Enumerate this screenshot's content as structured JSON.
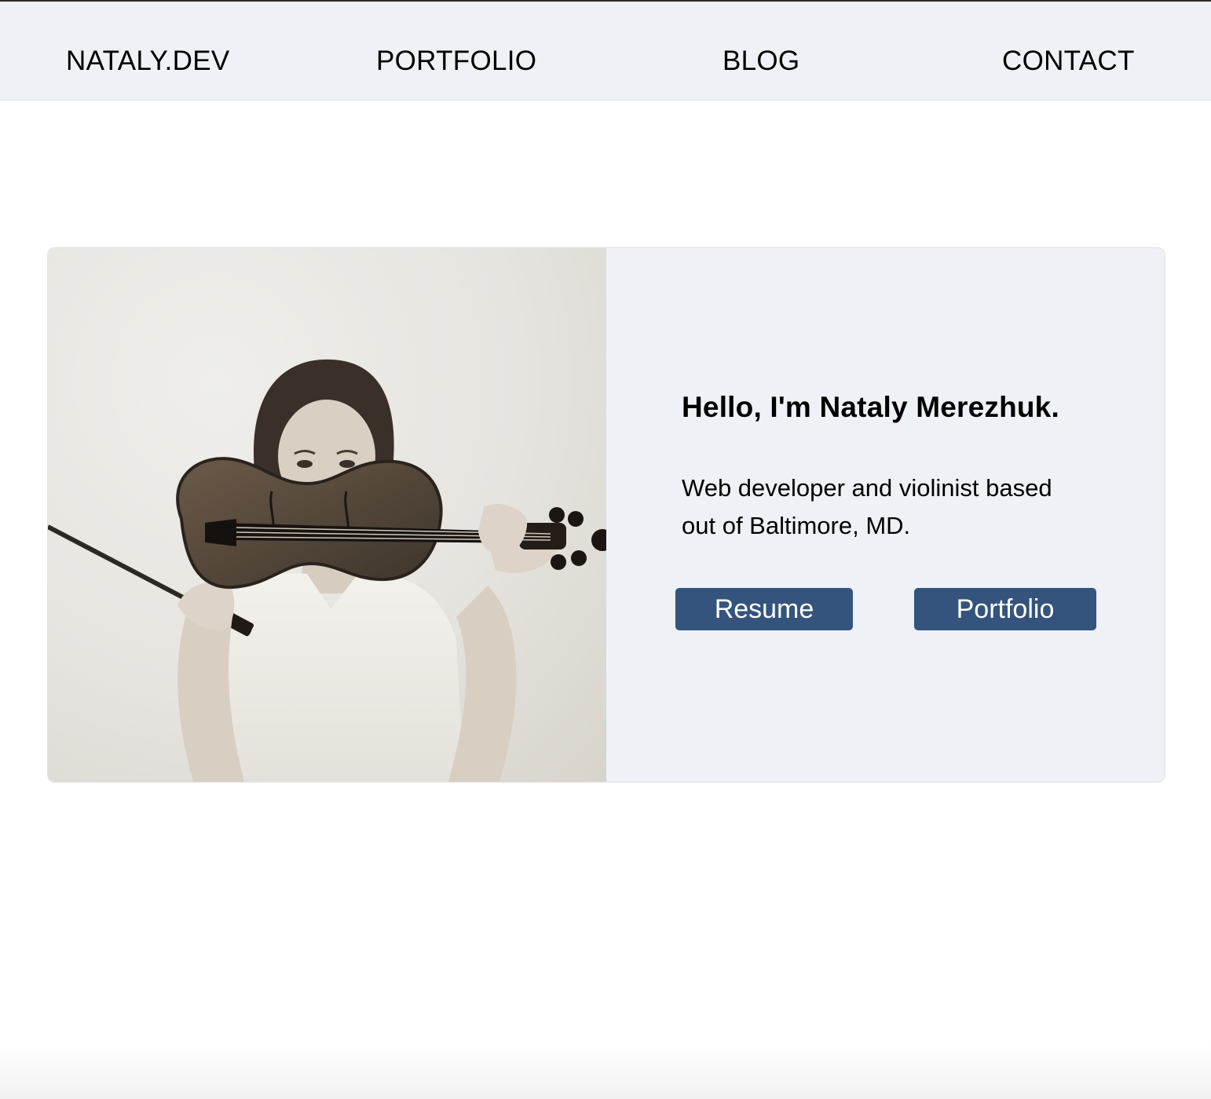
{
  "nav": {
    "brand": "NATALY.DEV",
    "links": [
      {
        "label": "PORTFOLIO"
      },
      {
        "label": "BLOG"
      },
      {
        "label": "CONTACT"
      }
    ]
  },
  "hero": {
    "heading": "Hello, I'm Nataly Merezhuk.",
    "description": "Web developer and violinist based out of Baltimore, MD.",
    "buttons": {
      "resume": "Resume",
      "portfolio": "Portfolio"
    },
    "photo_alt": "Woman holding a violin in front of her face"
  },
  "colors": {
    "nav_background": "#eef1f6",
    "card_background": "#eef1f6",
    "button_background": "#34547d",
    "button_text": "#ffffff"
  }
}
